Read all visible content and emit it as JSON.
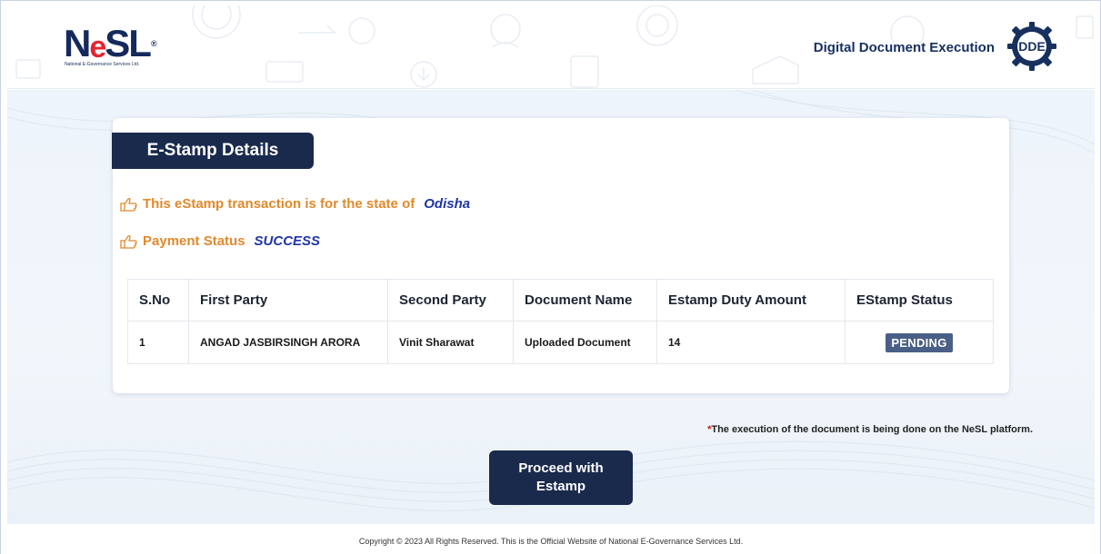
{
  "header": {
    "logo": {
      "brand_prefix": "N",
      "brand_e": "e",
      "brand_suffix": "SL",
      "reg": "®",
      "subtitle": "National E-Governance Services Ltd."
    },
    "title": "Digital Document Execution",
    "dde_logo_text": "DDE"
  },
  "card": {
    "title": "E-Stamp Details",
    "state_line": {
      "label": "This eStamp transaction is for the state of",
      "value": "Odisha"
    },
    "payment_line": {
      "label": "Payment Status",
      "value": "SUCCESS"
    },
    "table": {
      "headers": [
        "S.No",
        "First Party",
        "Second Party",
        "Document Name",
        "Estamp Duty Amount",
        "EStamp Status"
      ],
      "rows": [
        {
          "sno": "1",
          "first_party": "ANGAD JASBIRSINGH ARORA",
          "second_party": "Vinit Sharawat",
          "document_name": "Uploaded Document",
          "amount": "14",
          "status": "PENDING"
        }
      ]
    }
  },
  "note": {
    "star": "*",
    "text": "The execution of the document is being done on the NeSL platform."
  },
  "proceed_button": "Proceed with Estamp",
  "footer": {
    "text": "Copyright © 2023 All Rights Reserved. This is the Official Website of National E-Governance Services Ltd."
  },
  "colors": {
    "navy": "#192a4d",
    "orange": "#e0892b",
    "blue_value": "#1f36a6",
    "badge": "#4a5f86",
    "brand_red": "#e5262f"
  }
}
